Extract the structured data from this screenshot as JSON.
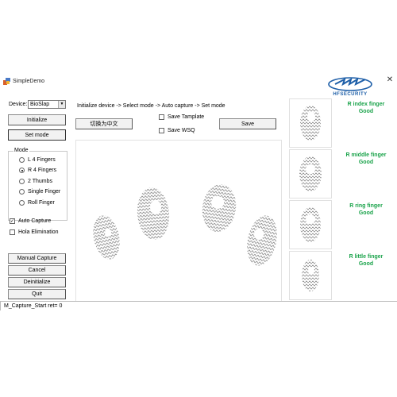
{
  "window": {
    "title": "SimpleDemo",
    "close_glyph": "✕"
  },
  "logo": {
    "text": "HFSECURITY"
  },
  "device": {
    "label": "Device:",
    "selected": "BioSlap"
  },
  "buttons": {
    "initialize": "Initialize",
    "set_mode": "Set mode",
    "switch_lang": "切换为中文",
    "save": "Save",
    "manual_capture": "Manual Capture",
    "cancel": "Cancel",
    "deinitialize": "Deinitialize",
    "quit": "Quit"
  },
  "instructions": "Initialize device -> Select mode -> Auto capture -> Set mode",
  "save_options": [
    {
      "label": "Save Tamplate",
      "checked": false
    },
    {
      "label": "Save WSQ",
      "checked": false
    }
  ],
  "mode": {
    "title": "Mode",
    "options": [
      {
        "label": "L 4 Fingers",
        "selected": false
      },
      {
        "label": "R 4 Fingers",
        "selected": true
      },
      {
        "label": "2 Thumbs",
        "selected": false
      },
      {
        "label": "Single Finger",
        "selected": false
      },
      {
        "label": "Roll Finger",
        "selected": false
      }
    ]
  },
  "options": {
    "auto_capture": {
      "label": "Auto Capture",
      "checked": true
    },
    "halo_elimination": {
      "label": "Hola Elimination",
      "checked": false
    }
  },
  "fingers": [
    {
      "name": "R index finger",
      "quality": "Good"
    },
    {
      "name": "R middle finger",
      "quality": "Good"
    },
    {
      "name": "R ring finger",
      "quality": "Good"
    },
    {
      "name": "R little finger",
      "quality": "Good"
    }
  ],
  "status": "M_Capture_Start  ret= 0",
  "colors": {
    "quality_good": "#1aa34a",
    "logo_blue": "#1e5fa8"
  },
  "icons": {
    "app": "app-icon",
    "close": "close-icon"
  }
}
